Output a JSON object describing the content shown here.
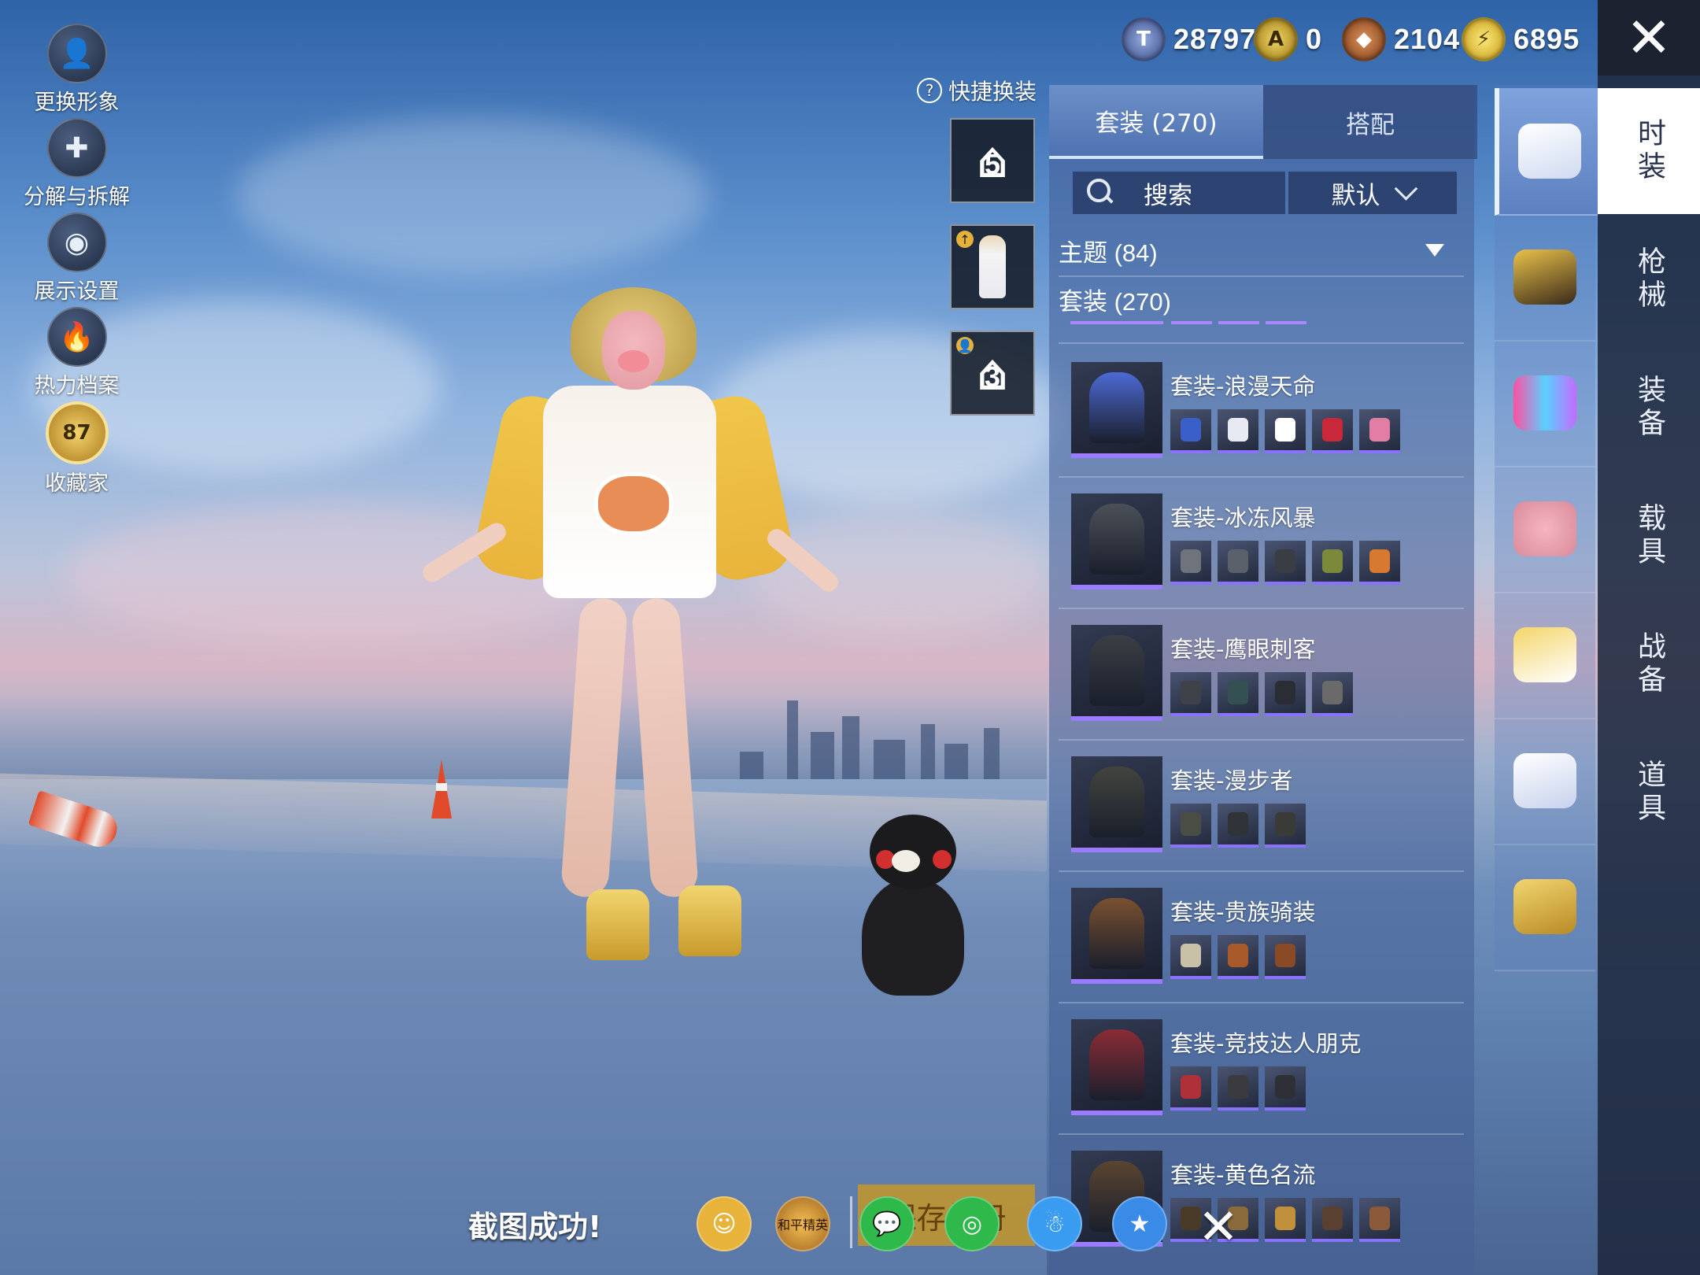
{
  "sidebar": {
    "items": [
      {
        "label": "更换形象",
        "icon": "avatar-icon"
      },
      {
        "label": "分解与拆解",
        "icon": "puzzle-icon"
      },
      {
        "label": "展示设置",
        "icon": "eye-icon"
      },
      {
        "label": "热力档案",
        "icon": "flame-icon"
      },
      {
        "label": "收藏家",
        "icon": "collector-badge-icon",
        "level": "87"
      }
    ]
  },
  "currencies": [
    {
      "icon": "t-coin-icon",
      "value": "28797",
      "color": "#6b86c8"
    },
    {
      "icon": "a-coin-icon",
      "value": "0",
      "color": "#d8b233"
    },
    {
      "icon": "bronze-coin-icon",
      "value": "2104",
      "color": "#b46a3a"
    },
    {
      "icon": "lightning-coin-icon",
      "value": "6895",
      "color": "#e7c43a"
    }
  ],
  "close_label": "✕",
  "quick_change": {
    "label": "快捷换装",
    "slots": [
      {
        "number": "5",
        "type": "hanger"
      },
      {
        "type": "character-preview"
      },
      {
        "number": "3",
        "type": "hanger"
      }
    ]
  },
  "panel": {
    "tabs": [
      {
        "label": "套装 (270)",
        "active": true
      },
      {
        "label": "搭配",
        "active": false
      }
    ],
    "search_label": "搜索",
    "sort_label": "默认",
    "theme_filter": "主题 (84)",
    "set_filter": "套装 (270)",
    "items": [
      {
        "name": "套装-浪漫天命",
        "pieces": 5,
        "colors": [
          "#3a5fc9",
          "#e7eaf2",
          "#ffffff",
          "#c8283a",
          "#e27ea4"
        ],
        "thumb": "#4d6ad4"
      },
      {
        "name": "套装-冰冻风暴",
        "pieces": 5,
        "colors": [
          "#6f737b",
          "#5b616b",
          "#3a3d44",
          "#7a8a3a",
          "#d77a2f"
        ],
        "thumb": "#4c5058"
      },
      {
        "name": "套装-鹰眼刺客",
        "pieces": 4,
        "colors": [
          "#3f4248",
          "#355052",
          "#2a2d33",
          "#6a6a6a"
        ],
        "thumb": "#3b3e44"
      },
      {
        "name": "套装-漫步者",
        "pieces": 3,
        "colors": [
          "#4a4d44",
          "#2f3236",
          "#3a3b36"
        ],
        "thumb": "#42453e"
      },
      {
        "name": "套装-贵族骑装",
        "pieces": 3,
        "colors": [
          "#c9c0a8",
          "#a85a2a",
          "#8a4a25"
        ],
        "thumb": "#7a5030"
      },
      {
        "name": "套装-竞技达人朋克",
        "pieces": 3,
        "colors": [
          "#b0303a",
          "#3a3a3f",
          "#2e3035"
        ],
        "thumb": "#8a2c35"
      },
      {
        "name": "套装-黄色名流",
        "pieces": 5,
        "colors": [
          "#4a3a28",
          "#8a6a3a",
          "#c0903a",
          "#5a4030",
          "#8a5a3a"
        ],
        "thumb": "#5a4530"
      }
    ]
  },
  "categories": [
    {
      "icon": "set-box-icon",
      "active": true
    },
    {
      "icon": "hat-icon",
      "active": false
    },
    {
      "icon": "goggles-icon",
      "active": false
    },
    {
      "icon": "pig-mask-icon",
      "active": false
    },
    {
      "icon": "jacket-icon",
      "active": false
    },
    {
      "icon": "pants-icon",
      "active": false
    },
    {
      "icon": "shoes-icon",
      "active": false
    }
  ],
  "main_tabs": [
    {
      "label": "时装",
      "active": true
    },
    {
      "label": "枪械",
      "active": false
    },
    {
      "label": "装备",
      "active": false
    },
    {
      "label": "载具",
      "active": false
    },
    {
      "label": "战备",
      "active": false
    },
    {
      "label": "道具",
      "active": false
    }
  ],
  "share_bar": {
    "message": "截图成功!",
    "save_label": "保存相册",
    "buttons": [
      {
        "icon": "game-friends-icon",
        "color": "#e7b33b"
      },
      {
        "icon": "game-logo-icon",
        "color": "#a0641f",
        "text": "和平精英"
      },
      {
        "icon": "wechat-icon",
        "color": "#2fb94a"
      },
      {
        "icon": "moments-icon",
        "color": "#2fb94a"
      },
      {
        "icon": "qq-icon",
        "color": "#3a9cf0"
      },
      {
        "icon": "qzone-icon",
        "color": "#3a8be8"
      }
    ],
    "close_label": "✕"
  }
}
